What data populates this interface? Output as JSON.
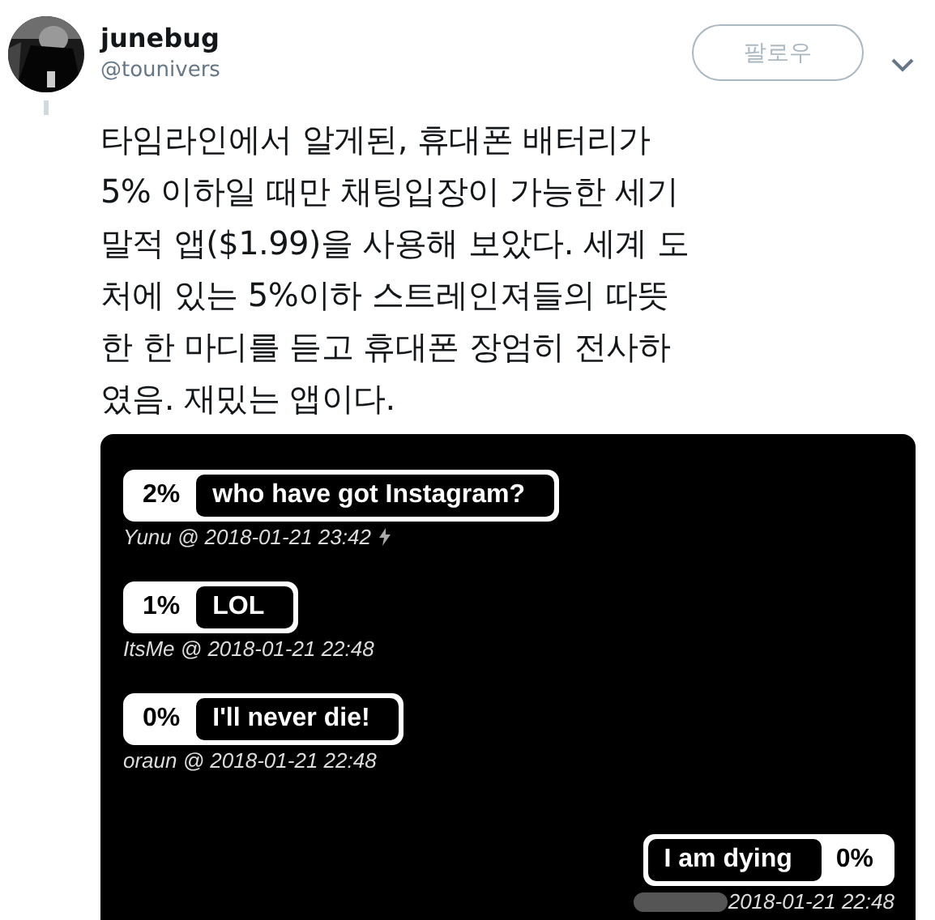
{
  "author": {
    "name": "junebug",
    "handle": "@tounivers"
  },
  "follow_button": {
    "label": "팔로우"
  },
  "tweet_text": "타임라인에서 알게된, 휴대폰 배터리가\n5% 이하일 때만 채팅입장이 가능한 세기\n말적 앱($1.99)을 사용해 보았다. 세계 도\n처에 있는 5%이하 스트레인져들의 따뜻\n한 한 마디를 듣고 휴대폰 장엄히 전사하\n였음. 재밌는 앱이다.",
  "attached_screenshot": {
    "messages": [
      {
        "kind": "incoming",
        "battery": "2%",
        "text": "who have got Instagram?",
        "meta": "Yunu @ 2018-01-21 23:42",
        "bolt": true,
        "redacted": false
      },
      {
        "kind": "incoming",
        "battery": "1%",
        "text": "LOL",
        "meta": "ItsMe @ 2018-01-21 22:48",
        "bolt": false,
        "redacted": false
      },
      {
        "kind": "incoming",
        "battery": "0%",
        "text": "I'll never die!",
        "meta": "oraun @ 2018-01-21 22:48",
        "bolt": false,
        "redacted": false
      },
      {
        "kind": "outgoing",
        "battery": "0%",
        "text": "I am dying",
        "meta": "2018-01-21 22:48",
        "bolt": false,
        "redacted": true
      }
    ]
  }
}
